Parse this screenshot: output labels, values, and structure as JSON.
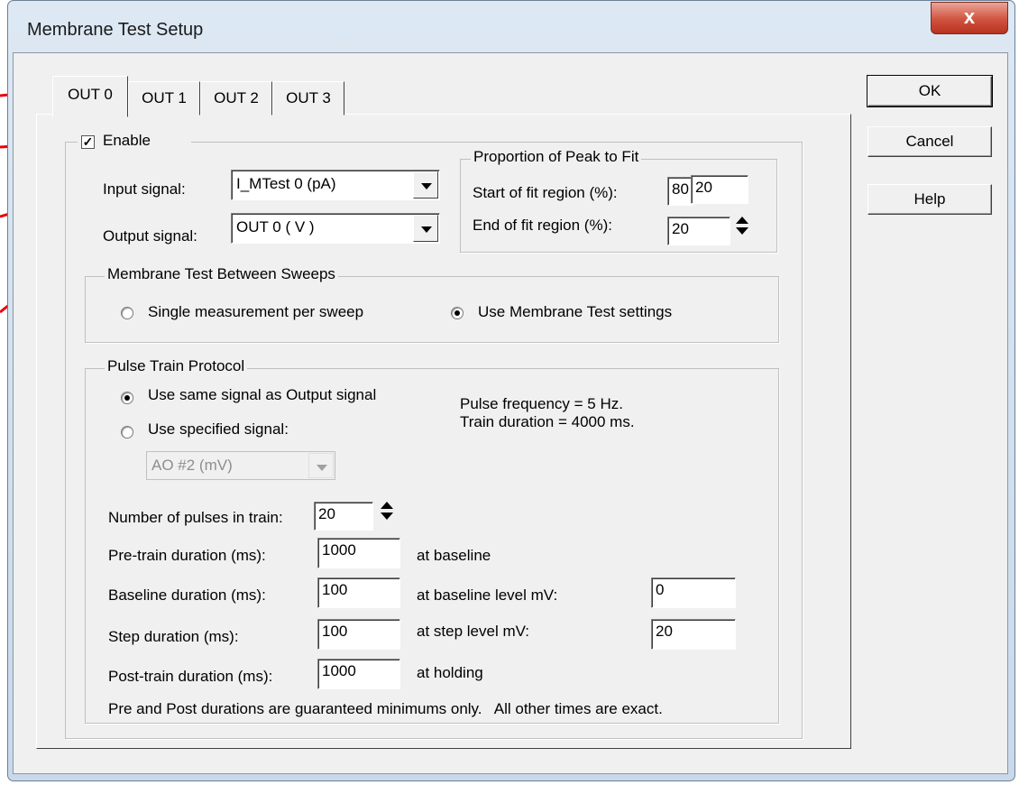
{
  "window": {
    "title": "Membrane Test Setup",
    "close_glyph": "x"
  },
  "tabs": [
    {
      "label": "OUT 0"
    },
    {
      "label": "OUT 1"
    },
    {
      "label": "OUT 2"
    },
    {
      "label": "OUT 3"
    }
  ],
  "buttons": {
    "ok": "OK",
    "cancel": "Cancel",
    "help": "Help"
  },
  "enable": {
    "label": "Enable",
    "checked": true,
    "mark": "✓"
  },
  "input_signal": {
    "label": "Input signal:",
    "value": "I_MTest 0 (pA)"
  },
  "output_signal": {
    "label": "Output signal:",
    "value": "OUT 0 ( V )"
  },
  "fit": {
    "title": "Proportion of Peak to Fit",
    "start_label": "Start of fit region (%):",
    "start_hidden": "80",
    "start_value": "20",
    "end_label": "End of fit region (%):",
    "end_value": "20"
  },
  "between_sweeps": {
    "title": "Membrane Test Between Sweeps",
    "option_single": "Single measurement per sweep",
    "option_use": "Use Membrane Test settings",
    "selected": "use"
  },
  "pulse_train": {
    "title": "Pulse Train Protocol",
    "option_same": "Use same signal as Output signal",
    "option_specified": "Use specified signal:",
    "selected": "same",
    "specified_value": "AO #2 (mV)",
    "freq_text": "Pulse frequency = 5 Hz.",
    "duration_text": "Train duration = 4000 ms.",
    "num_pulses_label": "Number of pulses in train:",
    "num_pulses": "20",
    "pre_label": "Pre-train duration (ms):",
    "pre_value": "1000",
    "pre_suffix": "at baseline",
    "baseline_label": "Baseline duration (ms):",
    "baseline_value": "100",
    "baseline_suffix": "at baseline level mV:",
    "baseline_level": "0",
    "step_label": "Step duration (ms):",
    "step_value": "100",
    "step_suffix": "at step level mV:",
    "step_level": "20",
    "post_label": "Post-train duration (ms):",
    "post_value": "1000",
    "post_suffix": "at holding",
    "note": "Pre and Post durations are guaranteed minimums only.   All other times are exact."
  },
  "colors": {
    "arrow": "#e8000b",
    "title_bar": "#c9d9ea",
    "face": "#f0f0f0"
  }
}
